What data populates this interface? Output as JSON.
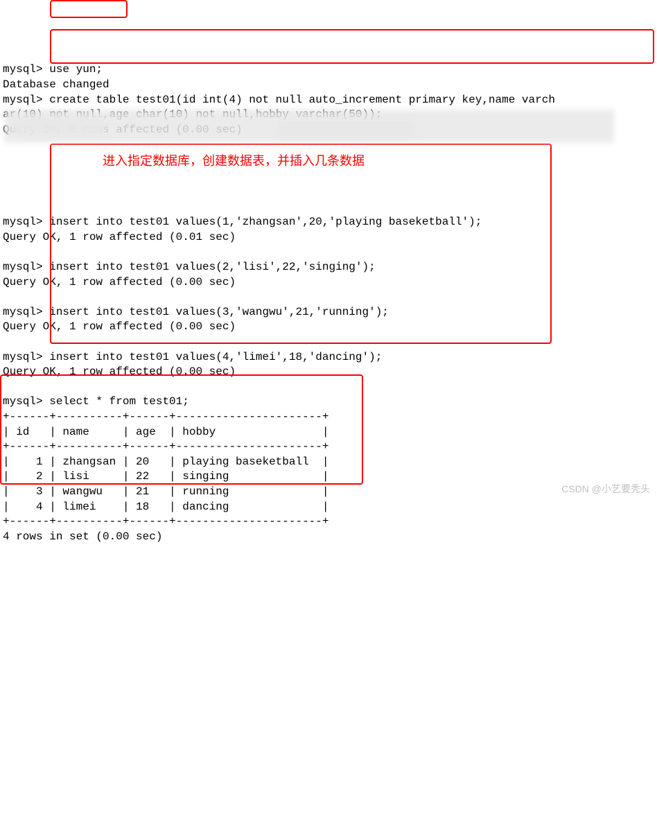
{
  "prompt": "mysql>",
  "cmd_use": "use yun;",
  "resp_use": "Database changed",
  "cmd_create_l1": "create table test01(id int(4) not null auto_increment primary key,name varch",
  "cmd_create_l2": "ar(10) not null,age char(10) not null,hobby varchar(50));",
  "resp_create": "Query OK, 0 rows affected (0.00 sec)",
  "annotation_text": "进入指定数据库，创建数据表，并插入几条数据",
  "cmd_ins1": "insert into test01 values(1,'zhangsan',20,'playing baseketball');",
  "resp_ins1": "Query OK, 1 row affected (0.01 sec)",
  "cmd_ins2": "insert into test01 values(2,'lisi',22,'singing');",
  "resp_ins2": "Query OK, 1 row affected (0.00 sec)",
  "cmd_ins3": "insert into test01 values(3,'wangwu',21,'running');",
  "resp_ins3": "Query OK, 1 row affected (0.00 sec)",
  "cmd_ins4": "insert into test01 values(4,'limei',18,'dancing');",
  "resp_ins4": "Query OK, 1 row affected (0.00 sec)",
  "cmd_select": "select * from test01;",
  "table_divider": "+------+----------+------+----------------------+",
  "table_header": "| id   | name     | age  | hobby                |",
  "table_row1": "|    1 | zhangsan | 20   | playing baseketball  |",
  "table_row2": "|    2 | lisi     | 22   | singing              |",
  "table_row3": "|    3 | wangwu   | 21   | running              |",
  "table_row4": "|    4 | limei    | 18   | dancing              |",
  "select_footer": "4 rows in set (0.00 sec)",
  "watermark": "CSDN @小艺要秃头",
  "chart_data": {
    "type": "table",
    "columns": [
      "id",
      "name",
      "age",
      "hobby"
    ],
    "rows": [
      [
        1,
        "zhangsan",
        20,
        "playing baseketball"
      ],
      [
        2,
        "lisi",
        22,
        "singing"
      ],
      [
        3,
        "wangwu",
        21,
        "running"
      ],
      [
        4,
        "limei",
        18,
        "dancing"
      ]
    ]
  }
}
